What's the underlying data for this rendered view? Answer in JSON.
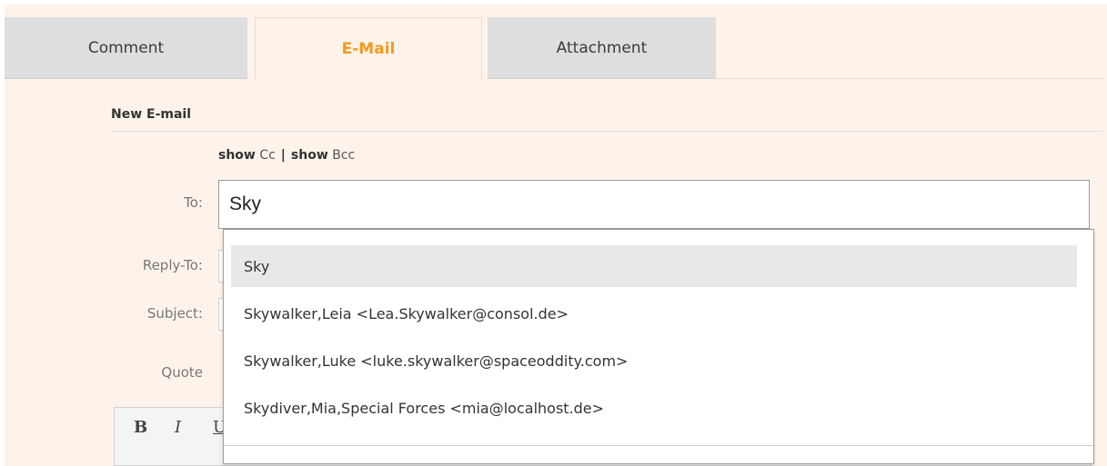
{
  "tabs": [
    {
      "label": "Comment"
    },
    {
      "label": "E-Mail",
      "active": true
    },
    {
      "label": "Attachment"
    }
  ],
  "section": {
    "title": "New E-mail"
  },
  "cc_bcc": {
    "show1": "show",
    "cc": "Cc",
    "separator": "|",
    "show2": "show",
    "bcc": "Bcc"
  },
  "form": {
    "to_label": "To:",
    "to_value": "Sky",
    "reply_to_label": "Reply-To:",
    "subject_label": "Subject:",
    "quote_label": "Quote"
  },
  "editor_toolbar": {
    "bold": "B",
    "italic": "I",
    "underline": "U"
  },
  "suggestions": [
    "Sky",
    "Skywalker,Leia <Lea.Skywalker@consol.de>",
    "Skywalker,Luke <luke.skywalker@spaceoddity.com>",
    "Skydiver,Mia,Special Forces <mia@localhost.de>"
  ],
  "colors": {
    "panel_bg": "#fdf3ea",
    "active_tab_text": "#f39a1e",
    "inactive_tab_bg": "#dedede",
    "highlight_bg": "#e8e8e8"
  }
}
